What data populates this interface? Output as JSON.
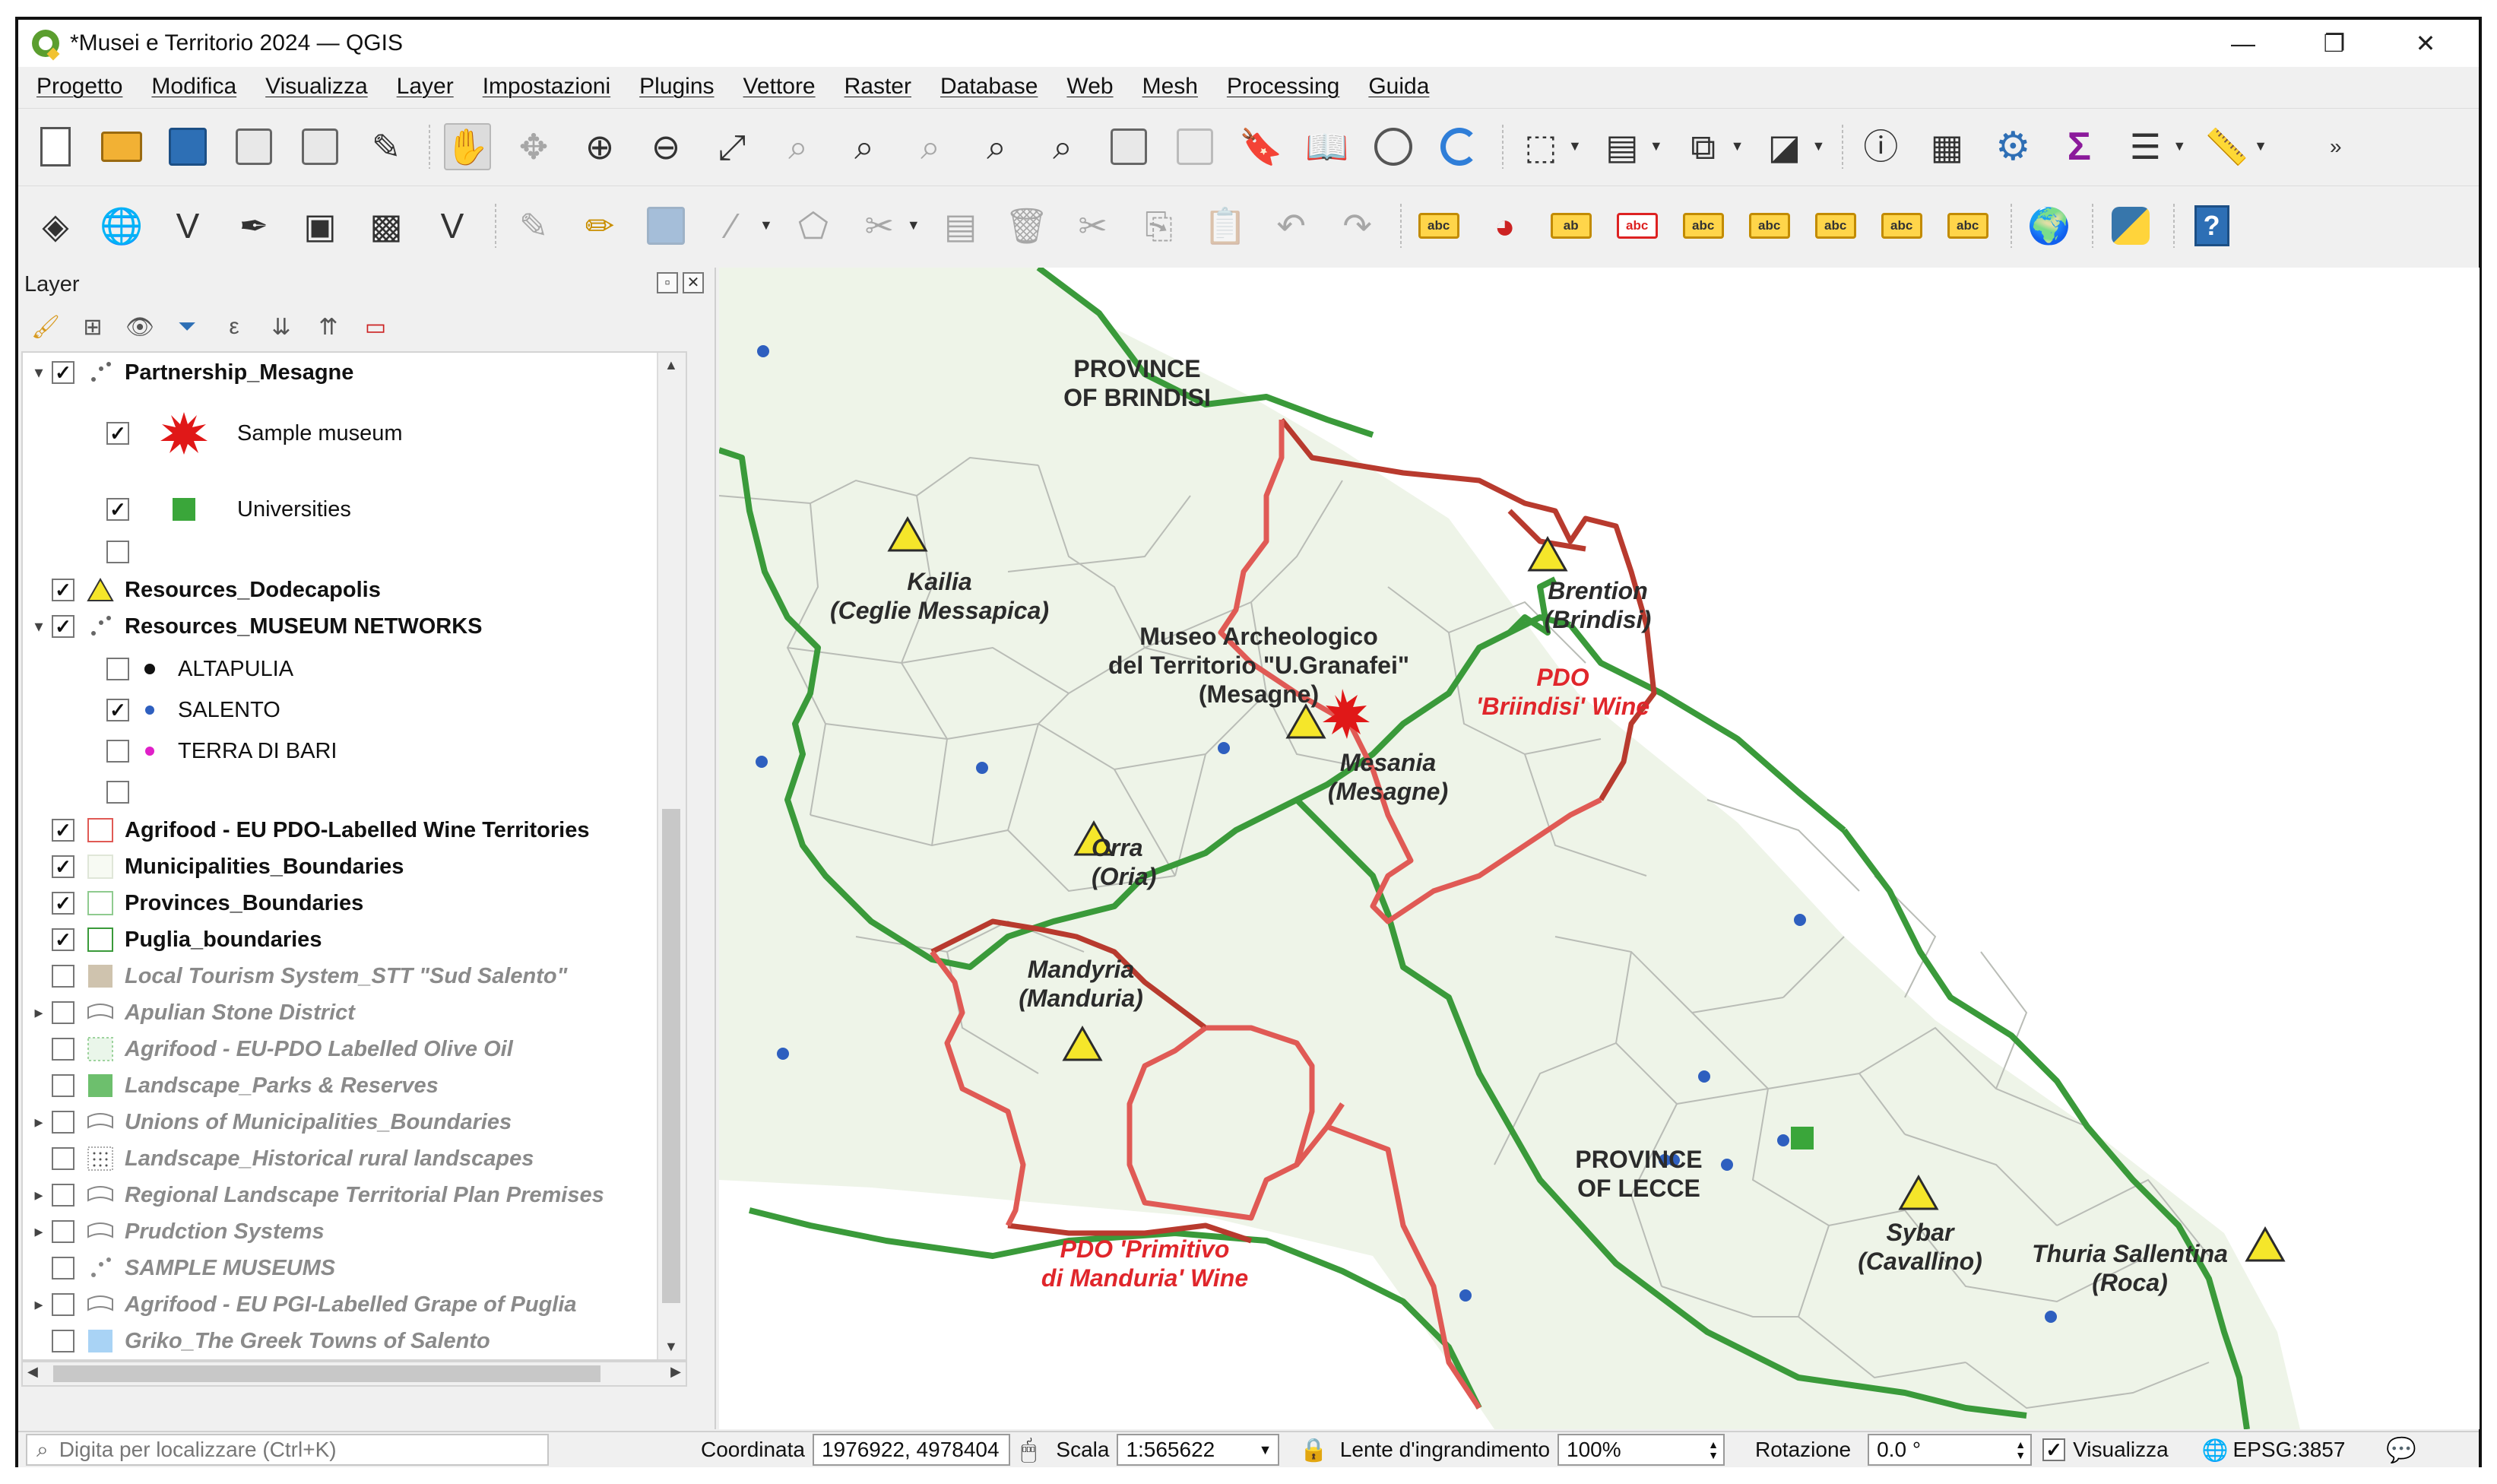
{
  "window": {
    "title": "*Musei e Territorio 2024 — QGIS",
    "minimize": "—",
    "restore": "❐",
    "close": "✕"
  },
  "menu": [
    "Progetto",
    "Modifica",
    "Visualizza",
    "Layer",
    "Impostazioni",
    "Plugins",
    "Vettore",
    "Raster",
    "Database",
    "Web",
    "Mesh",
    "Processing",
    "Guida"
  ],
  "toolbar2_labels": {
    "label1": "abc",
    "label2": "ab",
    "label3": "abc",
    "label4": "abc",
    "label5": "abc",
    "label6": "abc",
    "label7": "abc",
    "label8": "abc"
  },
  "layers_panel": {
    "title": "Layer",
    "items": [
      {
        "name": "Partnership_Mesagne",
        "checked": true,
        "style": "bold",
        "expand": "▾"
      },
      {
        "name": "Sample museum",
        "checked": true,
        "style": "normal"
      },
      {
        "name": "Universities",
        "checked": true,
        "style": "normal"
      },
      {
        "name": "",
        "checked": false,
        "style": "normal"
      },
      {
        "name": "Resources_Dodecapolis",
        "checked": true,
        "style": "bold"
      },
      {
        "name": "Resources_MUSEUM NETWORKS",
        "checked": true,
        "style": "bold",
        "expand": "▾"
      },
      {
        "name": "ALTAPULIA",
        "checked": false,
        "style": "normal"
      },
      {
        "name": "SALENTO",
        "checked": true,
        "style": "normal"
      },
      {
        "name": "TERRA DI BARI",
        "checked": false,
        "style": "normal"
      },
      {
        "name": "",
        "checked": false,
        "style": "normal"
      },
      {
        "name": "Agrifood - EU PDO-Labelled Wine Territories",
        "checked": true,
        "style": "bold"
      },
      {
        "name": "Municipalities_Boundaries",
        "checked": true,
        "style": "bold"
      },
      {
        "name": "Provinces_Boundaries",
        "checked": true,
        "style": "bold"
      },
      {
        "name": "Puglia_boundaries",
        "checked": true,
        "style": "bold"
      },
      {
        "name": "Local Tourism System_STT \"Sud Salento\"",
        "checked": false,
        "style": "off"
      },
      {
        "name": "Apulian Stone District",
        "checked": false,
        "style": "off",
        "expand": "▸"
      },
      {
        "name": "Agrifood - EU-PDO Labelled Olive Oil",
        "checked": false,
        "style": "off"
      },
      {
        "name": "Landscape_Parks & Reserves",
        "checked": false,
        "style": "off"
      },
      {
        "name": "Unions of Municipalities_Boundaries",
        "checked": false,
        "style": "off",
        "expand": "▸"
      },
      {
        "name": "Landscape_Historical rural landscapes",
        "checked": false,
        "style": "off"
      },
      {
        "name": "Regional Landscape Territorial Plan Premises",
        "checked": false,
        "style": "off",
        "expand": "▸"
      },
      {
        "name": "Prudction Systems",
        "checked": false,
        "style": "off",
        "expand": "▸"
      },
      {
        "name": "SAMPLE MUSEUMS",
        "checked": false,
        "style": "off"
      },
      {
        "name": "Agrifood - EU PGI-Labelled Grape of Puglia",
        "checked": false,
        "style": "off",
        "expand": "▸"
      },
      {
        "name": "Griko_The Greek Towns of Salento",
        "checked": false,
        "style": "off"
      }
    ]
  },
  "map_labels": {
    "brindisi": "PROVINCE\nOF BRINDISI",
    "lecce": "PROVINCE\nOF LECCE",
    "kailia": "Kailia\n(Ceglie Messapica)",
    "museo": "Museo Archeologico\ndel Territorio \"U.Granafei\"\n(Mesagne)",
    "mesania": "Mesania\n(Mesagne)",
    "brention": "Brention\n(Brindisi)",
    "pdo_brindisi": "PDO\n'Briindisi' Wine",
    "orra": "Orra\n(Oria)",
    "mandyria": "Mandyria\n(Manduria)",
    "pdo_primitivo": "PDO 'Primitivo\ndi Manduria' Wine",
    "sybar": "Sybar\n(Cavallino)",
    "thuria": "Thuria Sallentina\n(Roca)"
  },
  "colors": {
    "province_boundary": "#3a9a3a",
    "pdo_boundary": "#b83a2e",
    "pdo_boundary_light": "#e05a55",
    "land": "#eef4e8",
    "municipal": "#b9bcb6",
    "museum_dot": "#2e5fbf",
    "triangle": "#f5e62a",
    "university": "#3aa63a",
    "sample_museum": "#e01818"
  },
  "statusbar": {
    "locator_placeholder": "Digita per localizzare (Ctrl+K)",
    "coord_label": "Coordinata",
    "coord_value": "1976922, 4978404",
    "scale_label": "Scala",
    "scale_value": "1:565622",
    "magnifier_label": "Lente d'ingrandimento",
    "magnifier_value": "100%",
    "rotation_label": "Rotazione",
    "rotation_value": "0.0 °",
    "render_label": "Visualizza",
    "render_checked": true,
    "crs": "EPSG:3857"
  }
}
